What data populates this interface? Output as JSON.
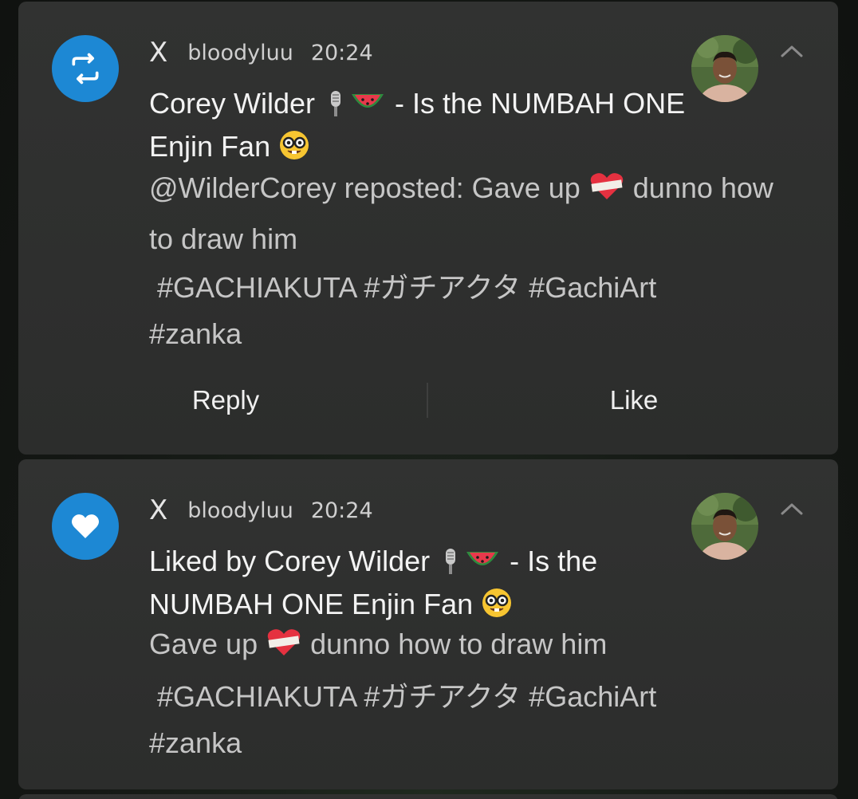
{
  "notifications": [
    {
      "app_name": "X",
      "account": "bloodyluu",
      "time": "20:24",
      "badge_icon": "repost-icon",
      "badge_color": "#1d88d4",
      "title_part1": "Corey Wilder ",
      "title_part2": " - Is the NUMBAH ONE Enjin Fan ",
      "body_part1": "@WilderCorey reposted: Gave up ",
      "body_part2": " dunno how to draw him",
      "hashtags_line1": " #GACHIAKUTA #ガチアクタ #GachiArt",
      "hashtags_line2": "#zanka",
      "actions": {
        "reply": "Reply",
        "like": "Like"
      }
    },
    {
      "app_name": "X",
      "account": "bloodyluu",
      "time": "20:24",
      "badge_icon": "heart-icon",
      "badge_color": "#1d88d4",
      "title_part1": "Liked by Corey Wilder ",
      "title_part2": " - Is the NUMBAH ONE Enjin Fan ",
      "body_part1": "Gave up ",
      "body_part2": " dunno how to draw him",
      "hashtags_line1": " #GACHIAKUTA #ガチアクタ #GachiArt",
      "hashtags_line2": "#zanka"
    }
  ]
}
